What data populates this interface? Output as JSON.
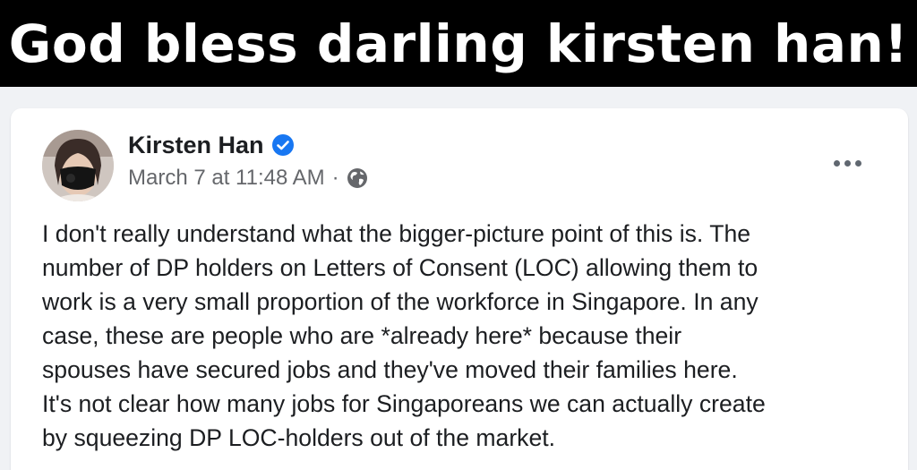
{
  "banner": {
    "caption": "God bless darling kirsten han!"
  },
  "post": {
    "author": "Kirsten Han",
    "verified": true,
    "timestamp": "March 7 at 11:48 AM",
    "separator": "·",
    "privacy_icon": "globe-icon",
    "more_icon": "more-options-icon",
    "body_lines": [
      "I don't really understand what the bigger-picture point of this is. The",
      "number of DP holders on Letters of Consent (LOC) allowing them to",
      "work is a very small proportion of the workforce in Singapore. In any",
      "case, these are people who are *already here* because their",
      "spouses have secured jobs and they've moved their families here.",
      "It's not clear how many jobs for Singaporeans we can actually create",
      "by squeezing DP LOC-holders out of the market."
    ]
  },
  "colors": {
    "banner_bg": "#000000",
    "verified_blue": "#1877f2",
    "meta_grey": "#65676b",
    "page_bg": "#f0f2f5"
  }
}
